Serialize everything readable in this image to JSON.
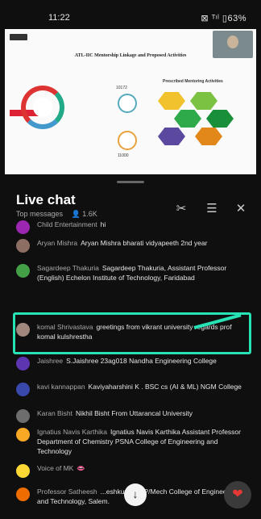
{
  "status_bar": {
    "time": "11:22",
    "indicators": "⊠ ᵀᶦˡ ▯63%"
  },
  "video": {
    "slide_title": "ATL-IIC Mentorship Linkage and Proposed Activities",
    "stats": [
      "10172",
      "11000"
    ],
    "panel_title": "Prescribed Mentoring Activities",
    "hex_colors": [
      "#f2c12e",
      "#7cc242",
      "#2eaa4a",
      "#1a8f3a",
      "#5b49a0",
      "#e2881b"
    ]
  },
  "chat": {
    "title": "Live chat",
    "subtitle": "Top messages",
    "viewer_count": "1.6K",
    "messages": [
      {
        "author": "Child Entertainment",
        "text": "hi",
        "avatar_color": "#9b27b0"
      },
      {
        "author": "Aryan Mishra",
        "text": "Aryan Mishra bharati vidyapeeth 2nd year",
        "avatar_color": "#8d6e63"
      },
      {
        "author": "Sagardeep Thakuria",
        "text": "Sagardeep Thakuria, Assistant Professor (English) Echelon Institute of Technology, Faridabad",
        "avatar_color": "#43a047"
      },
      {
        "author": "komal Shrivastava",
        "text": "greetings from vikrant university regards prof komal kulshrestha",
        "avatar_color": "#a1887f"
      },
      {
        "author": "Jaishree",
        "text": "S.Jaishree 23ag018 Nandha Engineering College",
        "avatar_color": "#5e35b1"
      },
      {
        "author": "kavi kannappan",
        "text": "Kaviyaharshini K . BSC cs (AI & ML) NGM College",
        "avatar_color": "#3949ab"
      },
      {
        "author": "Karan Bisht",
        "text": "Nikhil Bisht From Uttarancal University",
        "avatar_color": "#6d6d6d"
      },
      {
        "author": "Ignatius Navis Karthika",
        "text": "Ignatius Navis Karthika Assistant Professor Department of Chemistry PSNA College of Engineering and Technology",
        "avatar_color": "#f9a825"
      },
      {
        "author": "Voice of MK",
        "text": "👄",
        "avatar_color": "#fdd835"
      },
      {
        "author": "Professor Satheesh",
        "text": "...eshkumar, AP/Mech College of Engineering and Technology, Salem.",
        "avatar_color": "#ef6c00"
      }
    ]
  },
  "icons": {
    "views": "person-icon",
    "mute": "scissors-icon",
    "filter": "tune-icon",
    "close": "close-icon",
    "scroll_down": "arrow-down-icon",
    "like": "heart-icon"
  },
  "accent": "#27e2b4"
}
